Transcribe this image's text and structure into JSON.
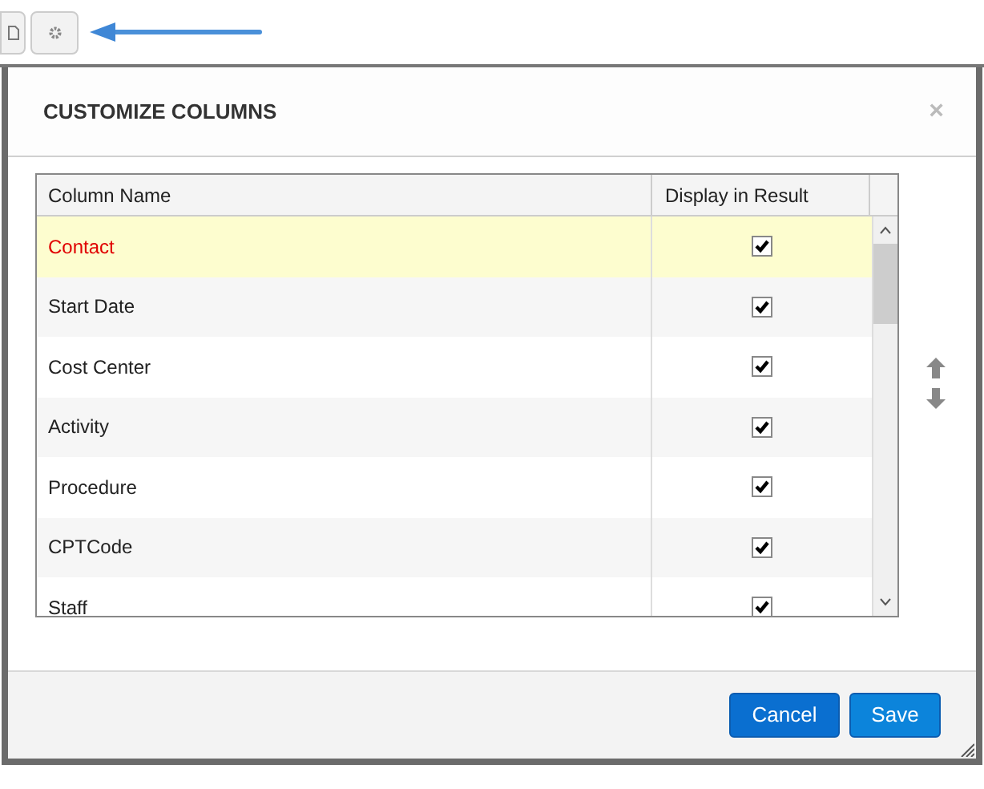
{
  "dialog": {
    "title": "CUSTOMIZE COLUMNS",
    "close": "×"
  },
  "table": {
    "columns": [
      "Column Name",
      "Display in Result"
    ],
    "rows": [
      {
        "name": "Contact",
        "checked": true,
        "selected": true
      },
      {
        "name": "Start Date",
        "checked": true,
        "selected": false
      },
      {
        "name": "Cost Center",
        "checked": true,
        "selected": false
      },
      {
        "name": "Activity",
        "checked": true,
        "selected": false
      },
      {
        "name": "Procedure",
        "checked": true,
        "selected": false
      },
      {
        "name": "CPTCode",
        "checked": true,
        "selected": false
      },
      {
        "name": "Staff",
        "checked": true,
        "selected": false
      }
    ]
  },
  "buttons": [
    "Cancel",
    "Save"
  ]
}
